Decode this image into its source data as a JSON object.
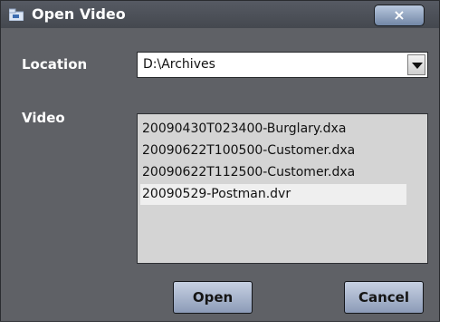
{
  "window": {
    "title": "Open Video",
    "icon": "folder-video-icon"
  },
  "location": {
    "label": "Location",
    "value": "D:\\Archives"
  },
  "video": {
    "label": "Video",
    "items": [
      "20090430T023400-Burglary.dxa",
      "20090622T100500-Customer.dxa",
      "20090622T112500-Customer.dxa",
      "20090529-Postman.dvr"
    ],
    "selected_index": 3
  },
  "buttons": {
    "open": "Open",
    "cancel": "Cancel",
    "close": "×"
  },
  "colors": {
    "dialog_bg": "#5f6166",
    "titlebar": "#4e5259",
    "button": "#aebbd1",
    "list_bg": "#d4d4d4"
  }
}
